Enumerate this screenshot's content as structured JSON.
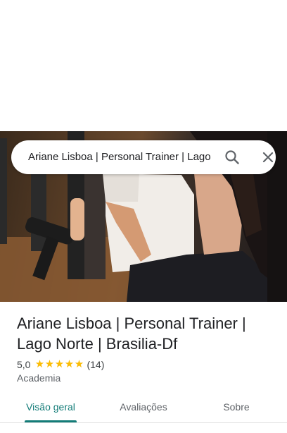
{
  "search": {
    "query": "Ariane Lisboa | Personal Trainer | Lago Norte | Brasilia-Df",
    "search_icon": "search-icon",
    "close_icon": "close-icon"
  },
  "hero": {
    "image_alt": "photo"
  },
  "place": {
    "title": "Ariane Lisboa | Personal Trainer | Lago Norte | Brasilia-Df",
    "rating": "5,0",
    "stars": 5,
    "review_count": "(14)",
    "category": "Academia"
  },
  "tabs": [
    {
      "label": "Visão geral",
      "active": true
    },
    {
      "label": "Avaliações",
      "active": false
    },
    {
      "label": "Sobre",
      "active": false
    }
  ],
  "colors": {
    "accent": "#137c78",
    "star": "#fbbc04"
  }
}
